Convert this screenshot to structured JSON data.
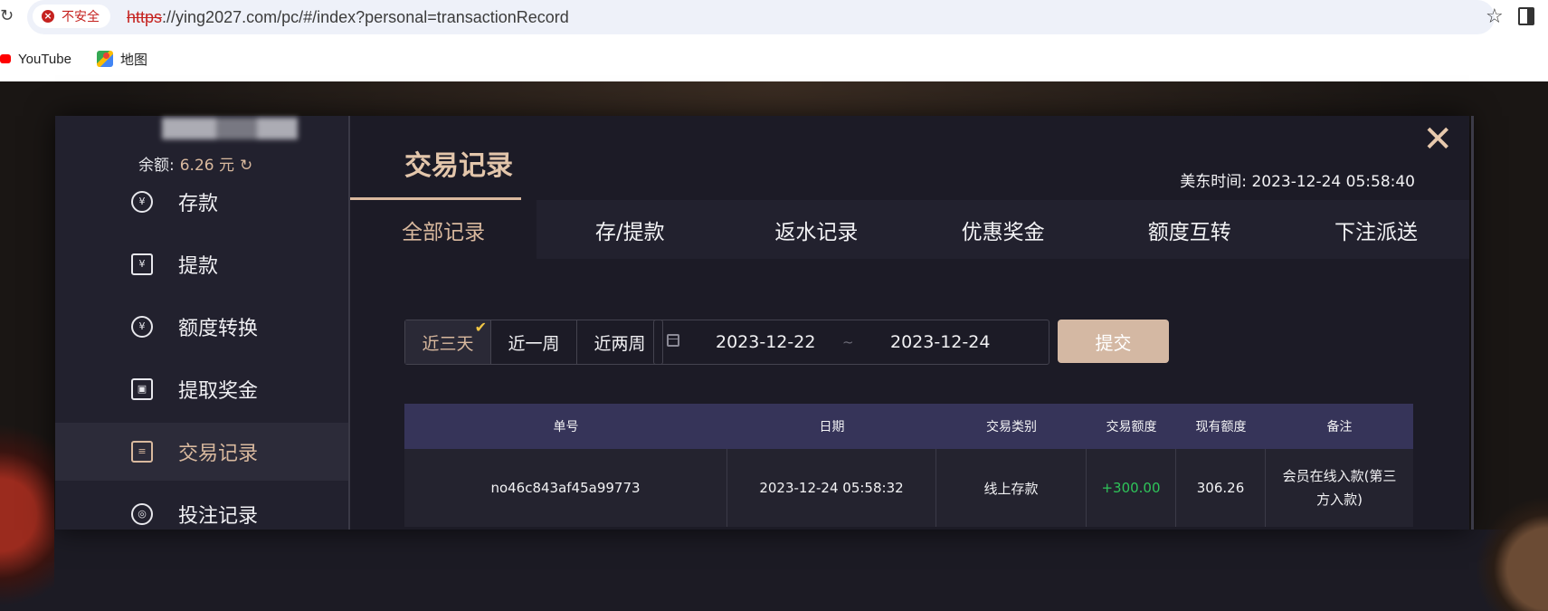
{
  "browser": {
    "security_label": "不安全",
    "url_scheme": "https",
    "url_rest": "://ying2027.com/pc/#/index?personal=transactionRecord",
    "bookmarks": [
      {
        "label": "YouTube",
        "icon": "youtube-icon"
      },
      {
        "label": "地图",
        "icon": "maps-icon"
      }
    ]
  },
  "sidebar": {
    "balance_label": "余额:",
    "balance_value": "6.26 元",
    "items": [
      {
        "label": "存款",
        "icon": "yen-circle-icon"
      },
      {
        "label": "提款",
        "icon": "ticket-icon"
      },
      {
        "label": "额度转换",
        "icon": "yen-refresh-icon"
      },
      {
        "label": "提取奖金",
        "icon": "gift-icon"
      },
      {
        "label": "交易记录",
        "icon": "clipboard-icon",
        "active": true
      },
      {
        "label": "投注记录",
        "icon": "bet-record-icon"
      }
    ]
  },
  "main": {
    "title": "交易记录",
    "time_label": "美东时间:",
    "time_value": "2023-12-24 05:58:40",
    "tabs": [
      {
        "label": "全部记录",
        "active": true
      },
      {
        "label": "存/提款"
      },
      {
        "label": "返水记录"
      },
      {
        "label": "优惠奖金"
      },
      {
        "label": "额度互转"
      },
      {
        "label": "下注派送"
      }
    ],
    "filters": {
      "quick": [
        {
          "label": "近三天",
          "active": true
        },
        {
          "label": "近一周"
        },
        {
          "label": "近两周"
        }
      ],
      "start_date": "2023-12-22",
      "end_date": "2023-12-24",
      "separator": "~",
      "submit_label": "提交"
    },
    "table": {
      "headers": [
        "单号",
        "日期",
        "交易类别",
        "交易额度",
        "现有额度",
        "备注"
      ],
      "rows": [
        [
          "no46c843af45a99773",
          "2023-12-24 05:58:32",
          "线上存款",
          "+300.00",
          "306.26",
          "会员在线入款(第三方入款)"
        ]
      ]
    }
  },
  "colors": {
    "accent": "#d9b99e",
    "panel": "#1c1b26",
    "table_header": "#363459",
    "positive": "#2fc55a",
    "submit": "#d4b8a3"
  }
}
